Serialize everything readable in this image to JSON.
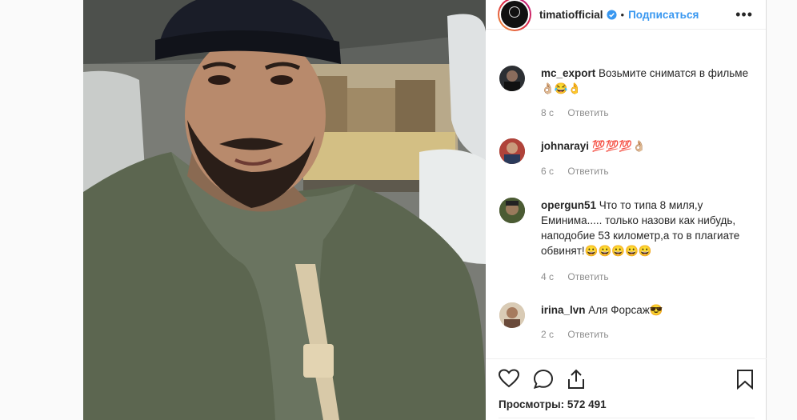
{
  "post": {
    "username": "timatiofficial",
    "follow_label": "Подписаться",
    "more_icon": "more-horizontal-icon",
    "dot": "•"
  },
  "comments": [
    {
      "username": "mc_export",
      "text": "Возьмите сниматся в фильме 👌🏼😂👌",
      "time": "8 с",
      "reply": "Ответить"
    },
    {
      "username": "johnarayi",
      "text": "💯💯💯👌🏼",
      "time": "6 с",
      "reply": "Ответить"
    },
    {
      "username": "opergun51",
      "text": "Что то типа 8 миля,у Еминима..... только назови как нибудь, наподобие 53 километр,а то в плагиате обвинят!😀😀😀😀😀",
      "time": "4 с",
      "reply": "Ответить"
    },
    {
      "username": "irina_lvn",
      "text": "Аля Форсаж😎",
      "time": "2 с",
      "reply": "Ответить"
    }
  ],
  "actions": {
    "like_icon": "heart-icon",
    "comment_icon": "comment-icon",
    "share_icon": "share-icon",
    "save_icon": "bookmark-icon"
  },
  "views": {
    "text": "Просмотры: 572 491"
  },
  "colors": {
    "link": "#3897f0",
    "meta": "#8e8e8e",
    "verified": "#3897f0"
  }
}
